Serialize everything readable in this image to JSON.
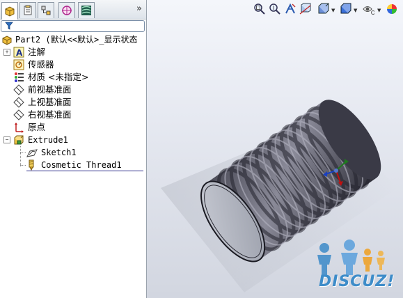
{
  "feature_manager": {
    "tab_overflow": "»",
    "tree": {
      "root": "Part2  (默认<<默认>_显示状态",
      "items": [
        {
          "label": "注解",
          "icon": "annotations-icon"
        },
        {
          "label": "传感器",
          "icon": "sensors-icon"
        },
        {
          "label": "材质 <未指定>",
          "icon": "material-icon"
        },
        {
          "label": "前视基准面",
          "icon": "plane-icon"
        },
        {
          "label": "上视基准面",
          "icon": "plane-icon"
        },
        {
          "label": "右视基准面",
          "icon": "plane-icon"
        },
        {
          "label": "原点",
          "icon": "origin-icon"
        },
        {
          "label": "Extrude1",
          "icon": "extrude-icon"
        }
      ],
      "children": [
        {
          "label": "Sketch1",
          "icon": "sketch-icon"
        },
        {
          "label": "Cosmetic Thread1",
          "icon": "cosmetic-thread-icon"
        }
      ]
    }
  },
  "watermark": {
    "text": "DISCUZ!"
  },
  "colors": {
    "accent": "#3d8cc9",
    "model": "#5a5a66"
  }
}
